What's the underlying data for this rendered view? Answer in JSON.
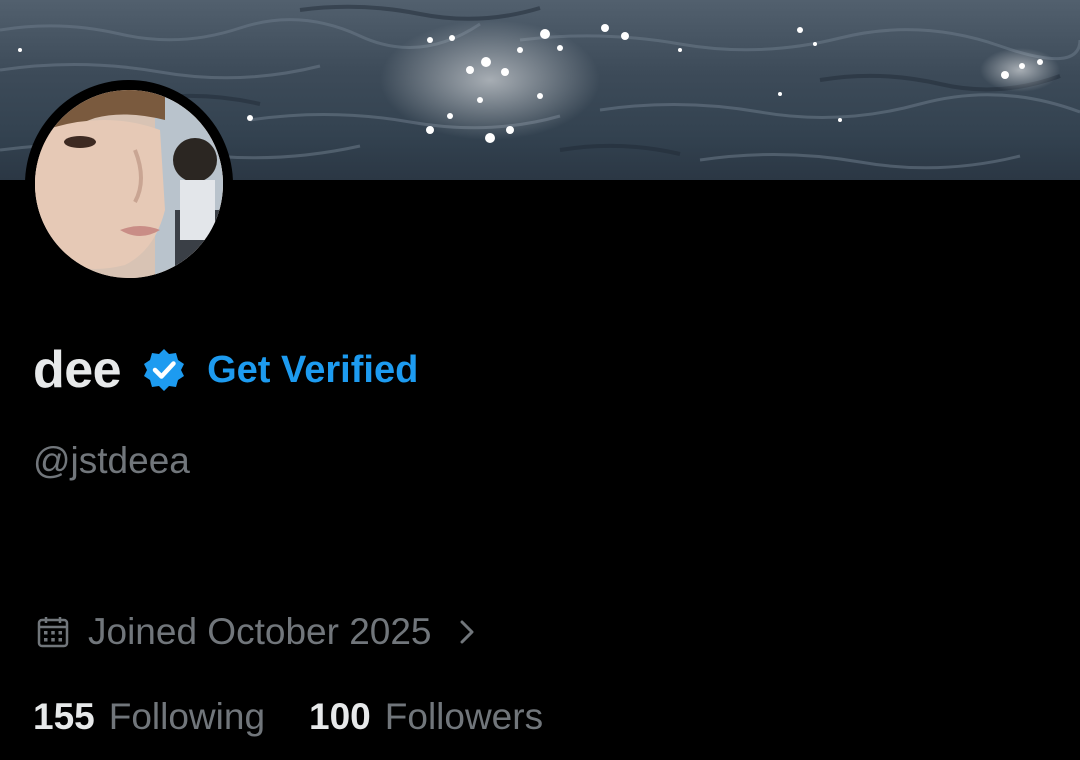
{
  "profile": {
    "display_name": "dee",
    "handle": "@jstdeea",
    "get_verified_label": "Get Verified",
    "joined_text": "Joined October 2025",
    "following_count": "155",
    "following_label": "Following",
    "followers_count": "100",
    "followers_label": "Followers"
  },
  "icons": {
    "verified_badge": "verified-badge-icon",
    "calendar": "calendar-icon",
    "chevron": "chevron-right-icon"
  },
  "colors": {
    "background": "#000000",
    "text_primary": "#e7e9ea",
    "text_secondary": "#71767b",
    "accent": "#1d9bf0"
  }
}
